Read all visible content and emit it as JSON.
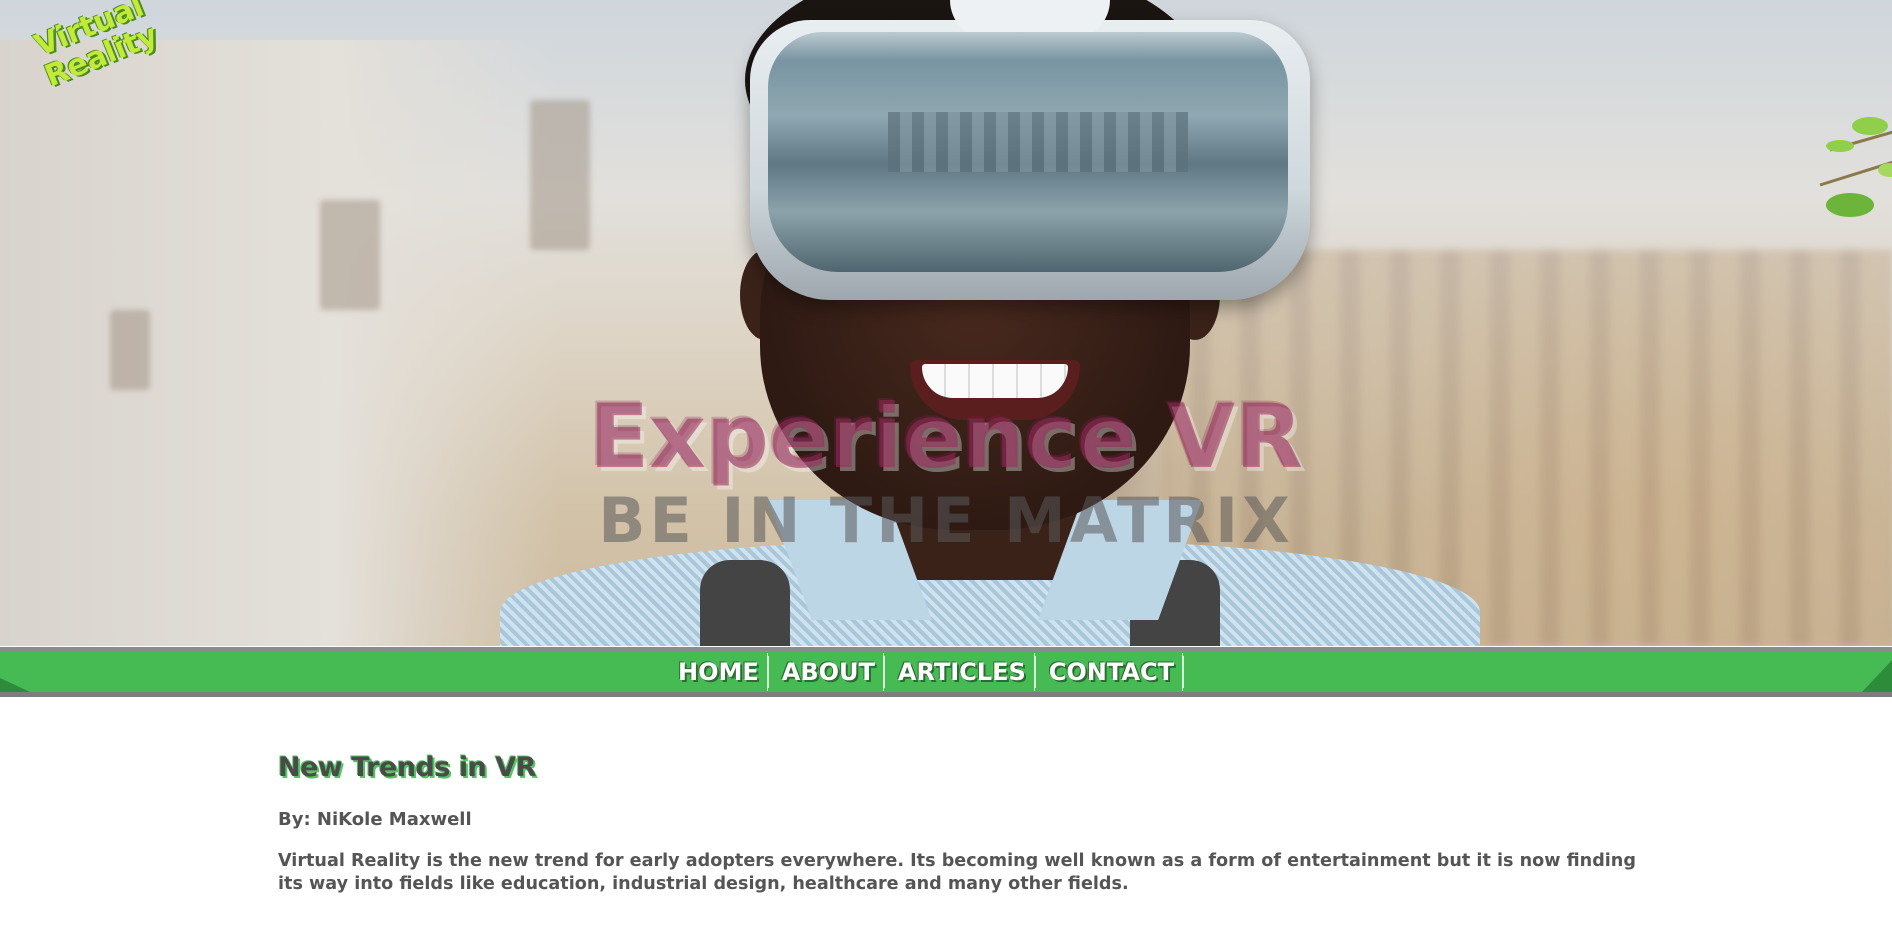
{
  "logo": {
    "line1": "Virtual",
    "line2": "Reality"
  },
  "hero": {
    "title": "Experience VR",
    "subtitle": "BE IN THE MATRIX"
  },
  "nav": {
    "items": [
      {
        "label": "HOME"
      },
      {
        "label": "ABOUT"
      },
      {
        "label": "ARTICLES"
      },
      {
        "label": "CONTACT"
      }
    ]
  },
  "article": {
    "title": "New Trends in VR",
    "byline": "By: NiKole Maxwell",
    "body": "Virtual Reality is the new trend for early adopters everywhere. Its becoming well known as a form of entertainment but it is now finding its way into fields like education, industrial design, healthcare and many other fields."
  },
  "colors": {
    "nav_green": "#46bb53",
    "logo_lime": "#c3e93a",
    "title_magenta": "#96285a",
    "text_gray": "#555555"
  }
}
